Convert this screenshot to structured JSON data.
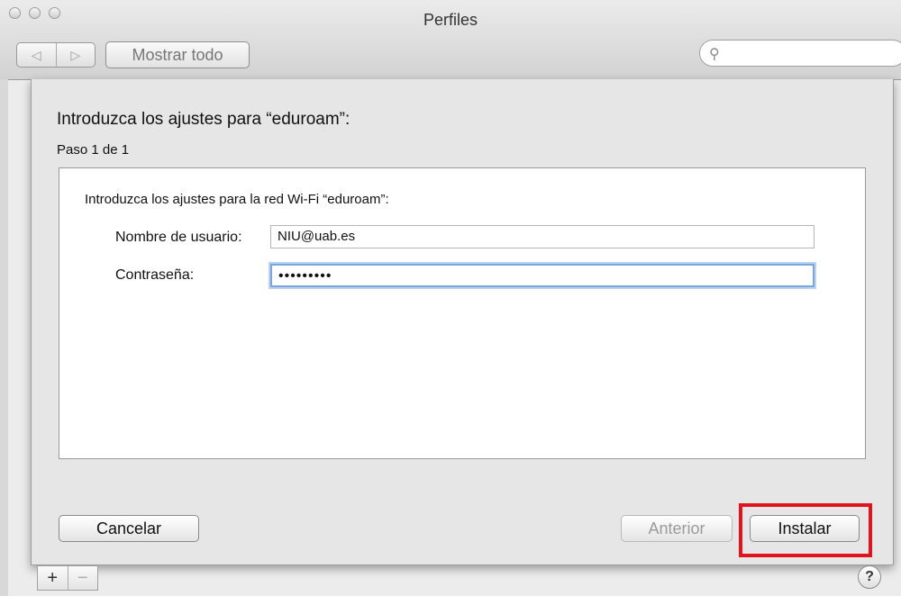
{
  "window": {
    "title": "Perfiles"
  },
  "toolbar": {
    "back_icon": "back-arrow-icon",
    "forward_icon": "forward-arrow-icon",
    "show_all_label": "Mostrar todo",
    "search_placeholder": ""
  },
  "sheet": {
    "title": "Introduzca los ajustes para “eduroam”:",
    "step": "Paso 1 de 1",
    "inner_label": "Introduzca los ajustes para la red Wi-Fi “eduroam”:",
    "username_label": "Nombre de usuario:",
    "username_value": "NIU@uab.es",
    "password_label": "Contraseña:",
    "password_value": "•••••••••",
    "cancel_label": "Cancelar",
    "previous_label": "Anterior",
    "install_label": "Instalar"
  },
  "footer": {
    "add_label": "+",
    "remove_label": "−",
    "help_label": "?"
  },
  "colors": {
    "highlight": "#e0141c",
    "focus_ring": "#7aa7e0"
  }
}
